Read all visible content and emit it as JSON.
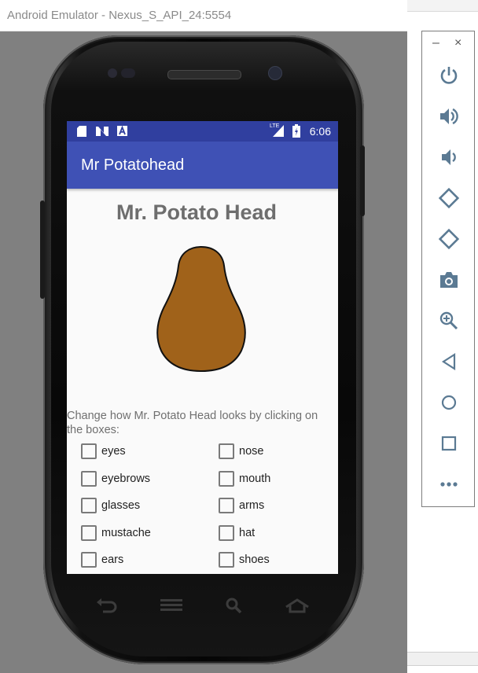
{
  "window": {
    "title": "Android Emulator - Nexus_S_API_24:5554"
  },
  "status_bar": {
    "time": "6:06",
    "network": "LTE"
  },
  "app_bar": {
    "title": "Mr Potatohead"
  },
  "main": {
    "heading": "Mr. Potato Head",
    "instructions": "Change how Mr. Potato Head looks by clicking on the boxes:",
    "checkboxes": [
      {
        "label": "eyes",
        "checked": false
      },
      {
        "label": "nose",
        "checked": false
      },
      {
        "label": "eyebrows",
        "checked": false
      },
      {
        "label": "mouth",
        "checked": false
      },
      {
        "label": "glasses",
        "checked": false
      },
      {
        "label": "arms",
        "checked": false
      },
      {
        "label": "mustache",
        "checked": false
      },
      {
        "label": "hat",
        "checked": false
      },
      {
        "label": "ears",
        "checked": false
      },
      {
        "label": "shoes",
        "checked": false
      }
    ]
  },
  "colors": {
    "status_bar": "#303f9f",
    "app_bar": "#3f51b5",
    "potato_body": "#a0621a",
    "toolbar_icon": "#5b7a93"
  },
  "tool_panel": {
    "window_controls": [
      "minimize-icon",
      "close-icon"
    ],
    "buttons": [
      "power-icon",
      "volume-up-icon",
      "volume-down-icon",
      "rotate-left-icon",
      "rotate-right-icon",
      "camera-icon",
      "zoom-icon",
      "back-icon",
      "home-icon",
      "overview-icon",
      "more-icon"
    ]
  },
  "phone_keys": [
    "back-key-icon",
    "menu-key-icon",
    "search-key-icon",
    "home-key-icon"
  ]
}
